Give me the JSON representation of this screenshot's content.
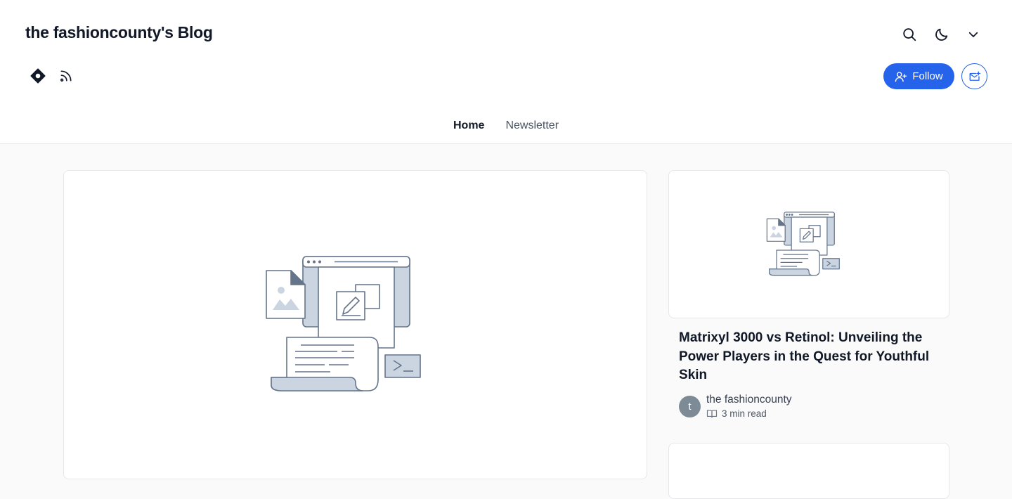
{
  "header": {
    "blog_title": "the fashioncounty's Blog",
    "icons": [
      "search-icon",
      "moon-icon",
      "chevron-down-icon",
      "hashnode-icon",
      "rss-icon",
      "mail-plus-icon",
      "user-plus-icon"
    ],
    "follow_label": "Follow",
    "accent_color": "#2563eb"
  },
  "nav": {
    "tabs": [
      {
        "label": "Home",
        "active": true
      },
      {
        "label": "Newsletter",
        "active": false
      }
    ]
  },
  "posts": [
    {
      "title": "Matrixyl 3000 vs Retinol: Unveiling the Power Players in the Quest for Youthful Skin",
      "author": "the fashioncounty",
      "avatar_initial": "t",
      "read_time": "3 min read"
    }
  ]
}
